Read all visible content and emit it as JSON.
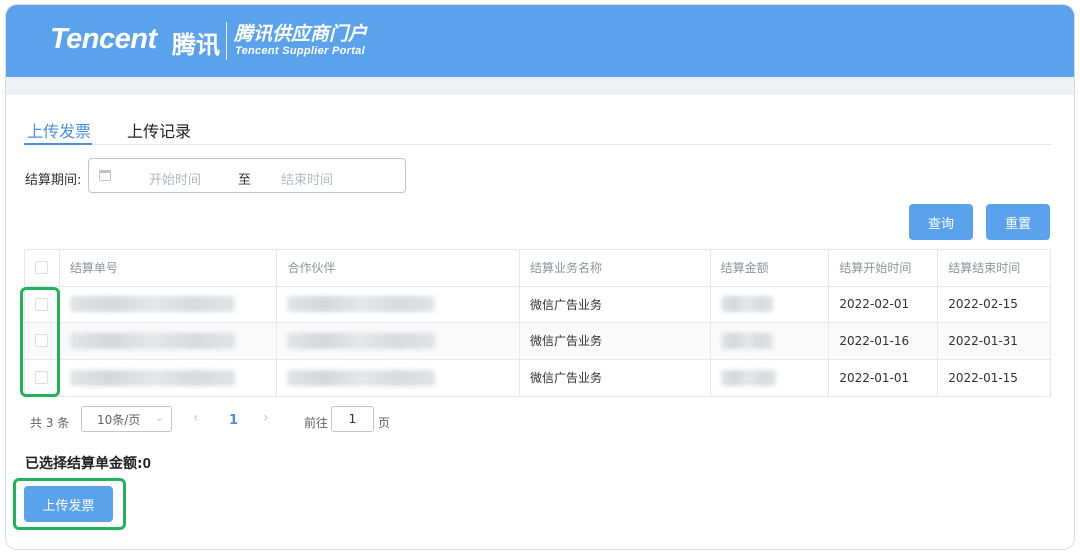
{
  "header": {
    "logo_en": "Tencent",
    "logo_cn": "腾讯",
    "portal_cn": "腾讯供应商门户",
    "portal_en": "Tencent Supplier Portal"
  },
  "tabs": [
    {
      "label": "上传发票",
      "active": true
    },
    {
      "label": "上传记录",
      "active": false
    }
  ],
  "filter": {
    "label": "结算期间:",
    "start_placeholder": "开始时间",
    "separator": "至",
    "end_placeholder": "结束时间"
  },
  "buttons": {
    "query": "查询",
    "reset": "重置",
    "upload": "上传发票"
  },
  "table": {
    "columns": [
      "结算单号",
      "合作伙伴",
      "结算业务名称",
      "结算金额",
      "结算开始时间",
      "结算结束时间"
    ],
    "rows": [
      {
        "business_name": "微信广告业务",
        "start": "2022-02-01",
        "end": "2022-02-15"
      },
      {
        "business_name": "微信广告业务",
        "start": "2022-01-16",
        "end": "2022-01-31"
      },
      {
        "business_name": "微信广告业务",
        "start": "2022-01-01",
        "end": "2022-01-15"
      }
    ]
  },
  "pagination": {
    "total": "共 3 条",
    "page_size": "10条/页",
    "current_page": "1",
    "goto_label": "前往",
    "goto_value": "1",
    "page_suffix": "页"
  },
  "summary": {
    "label": "已选择结算单金额:",
    "value": "0"
  },
  "colors": {
    "header_bg": "#5aa2ec",
    "accent": "#4a8fe0",
    "highlight": "#1fb45b"
  }
}
